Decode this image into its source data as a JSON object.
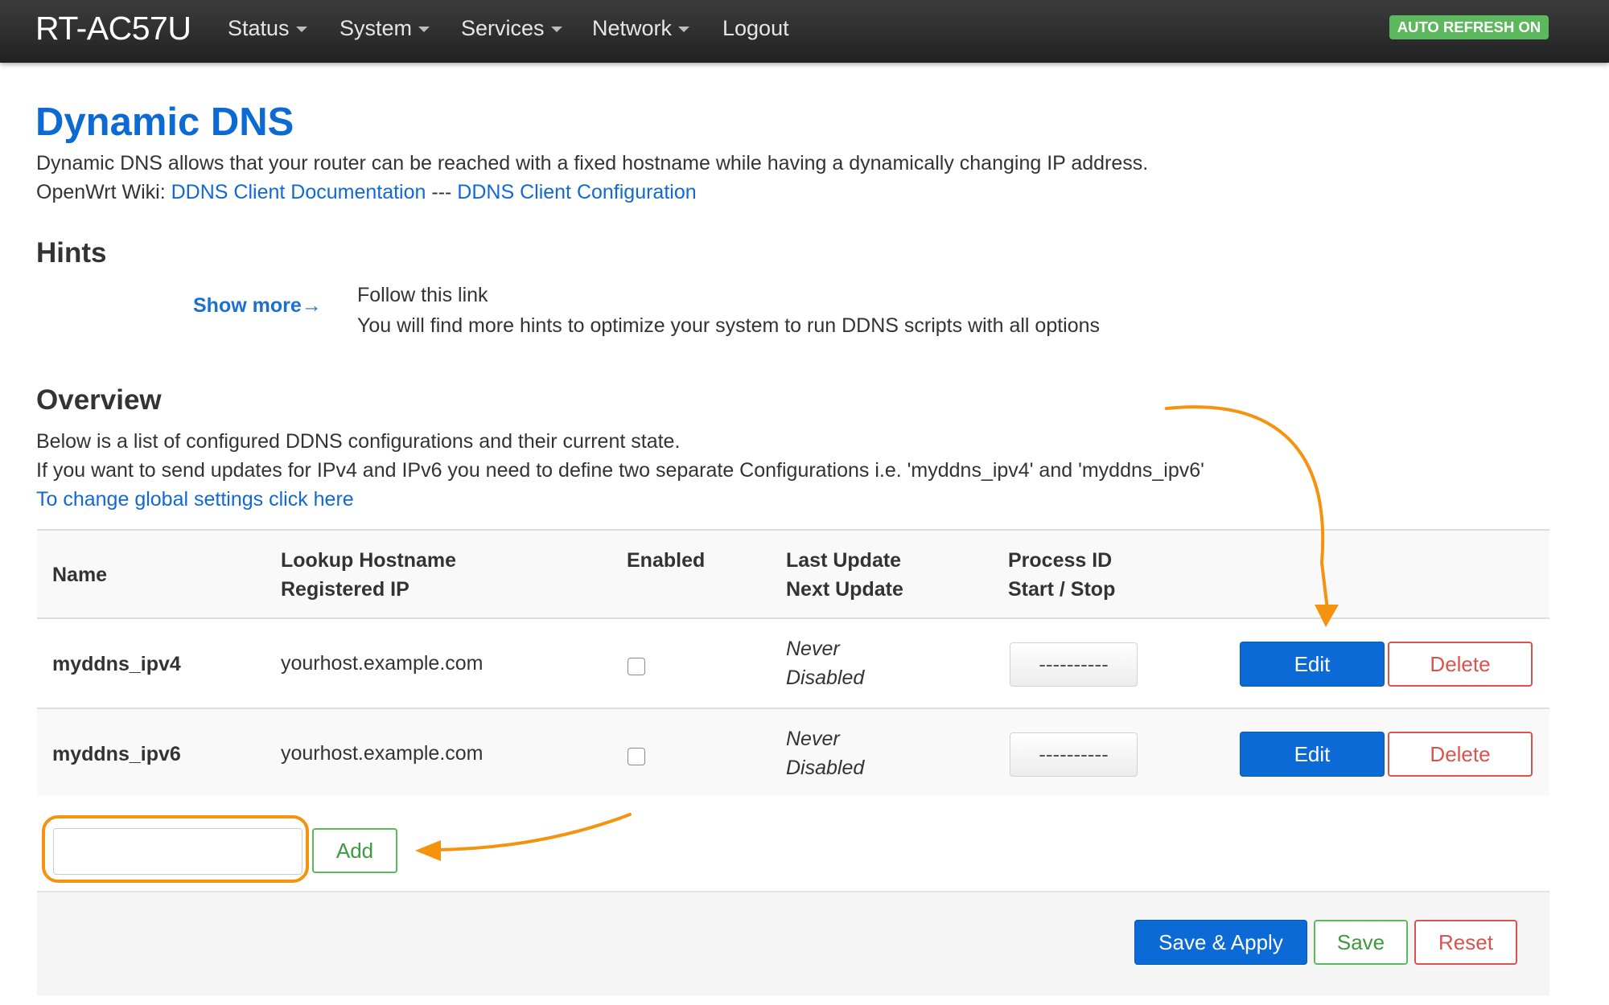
{
  "navbar": {
    "brand": "RT-AC57U",
    "menu": [
      {
        "label": "Status",
        "dropdown": true
      },
      {
        "label": "System",
        "dropdown": true
      },
      {
        "label": "Services",
        "dropdown": true
      },
      {
        "label": "Network",
        "dropdown": true
      },
      {
        "label": "Logout",
        "dropdown": false
      }
    ],
    "auto_refresh": "AUTO REFRESH ON"
  },
  "page": {
    "title": "Dynamic DNS",
    "description": "Dynamic DNS allows that your router can be reached with a fixed hostname while having a dynamically changing IP address.",
    "wiki_prefix": "OpenWrt Wiki: ",
    "wiki_link_1": "DDNS Client Documentation",
    "wiki_separator": " --- ",
    "wiki_link_2": "DDNS Client Configuration"
  },
  "hints": {
    "heading": "Hints",
    "show_more": "Show more",
    "show_more_arrow": "→",
    "line1": "Follow this link",
    "line2": "You will find more hints to optimize your system to run DDNS scripts with all options"
  },
  "overview": {
    "heading": "Overview",
    "line1": "Below is a list of configured DDNS configurations and their current state.",
    "line2": "If you want to send updates for IPv4 and IPv6 you need to define two separate Configurations i.e. 'myddns_ipv4' and 'myddns_ipv6'",
    "global_link": "To change global settings click here"
  },
  "table": {
    "headers": {
      "name": "Name",
      "hostname_1": "Lookup Hostname",
      "hostname_2": "Registered IP",
      "enabled": "Enabled",
      "update_1": "Last Update",
      "update_2": "Next Update",
      "process_1": "Process ID",
      "process_2": "Start / Stop"
    },
    "rows": [
      {
        "name": "myddns_ipv4",
        "hostname": "yourhost.example.com",
        "enabled": false,
        "last_update": "Never",
        "next_update": "Disabled",
        "process": "----------",
        "edit": "Edit",
        "delete": "Delete"
      },
      {
        "name": "myddns_ipv6",
        "hostname": "yourhost.example.com",
        "enabled": false,
        "last_update": "Never",
        "next_update": "Disabled",
        "process": "----------",
        "edit": "Edit",
        "delete": "Delete"
      }
    ]
  },
  "add_form": {
    "input_value": "",
    "add_label": "Add"
  },
  "footer": {
    "save_apply": "Save & Apply",
    "save": "Save",
    "reset": "Reset"
  },
  "colors": {
    "accent": "#0b6ad6",
    "success": "#5cb85c",
    "danger": "#d9534f",
    "annotation": "#f5920e"
  }
}
